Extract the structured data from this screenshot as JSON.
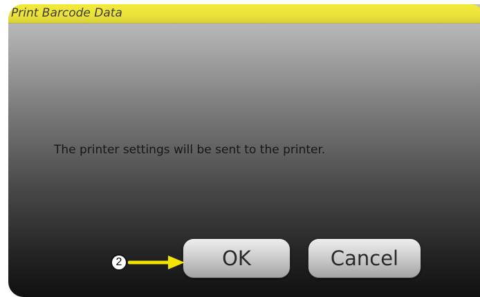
{
  "dialog": {
    "title": "Print Barcode Data",
    "message": "The printer settings will be sent to the printer.",
    "ok_label": "OK",
    "cancel_label": "Cancel"
  },
  "annotation": {
    "step_number": "2",
    "arrow_color": "#f2e400"
  },
  "colors": {
    "title_bar": "#ece33a",
    "dialog_top": "#c4c4c4",
    "dialog_bottom": "#101010"
  }
}
